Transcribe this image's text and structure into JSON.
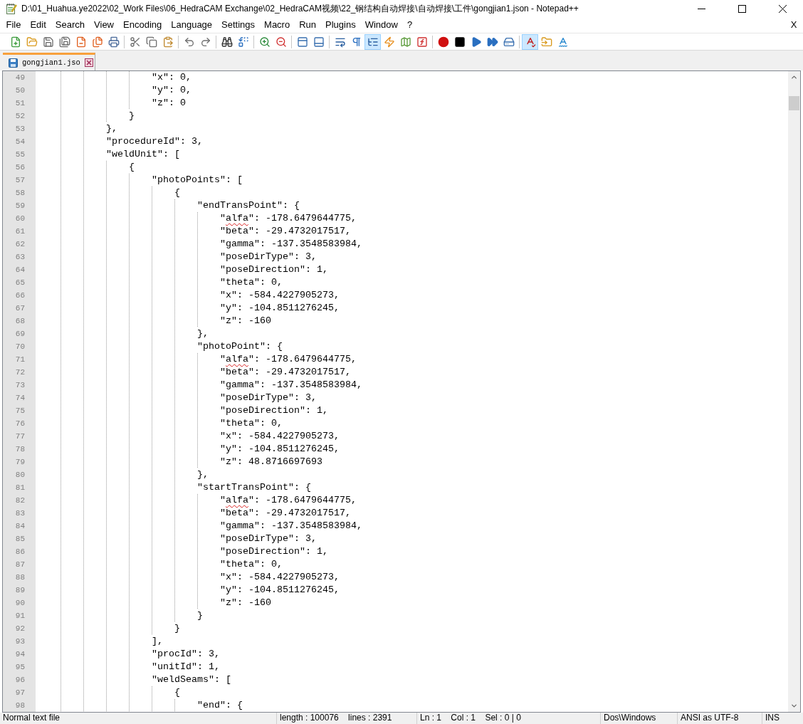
{
  "window": {
    "title": "D:\\01_Huahua.ye2022\\02_Work Files\\06_HedraCAM Exchange\\02_HedraCAM视频\\22_钢结构自动焊接\\自动焊接\\工件\\gongjian1.json - Notepad++"
  },
  "menu": {
    "items": [
      "File",
      "Edit",
      "Search",
      "View",
      "Encoding",
      "Language",
      "Settings",
      "Macro",
      "Run",
      "Plugins",
      "Window",
      "?"
    ],
    "close": "X"
  },
  "toolbar": {
    "groups": [
      {
        "buttons": [
          {
            "pressed": false
          },
          {
            "pressed": false
          },
          {
            "pressed": false
          },
          {
            "pressed": false
          },
          {
            "pressed": false
          },
          {
            "pressed": false
          },
          {
            "pressed": false
          }
        ]
      },
      {
        "buttons": [
          {
            "pressed": false
          },
          {
            "pressed": false
          },
          {
            "pressed": false
          }
        ]
      },
      {
        "buttons": [
          {
            "pressed": false
          },
          {
            "pressed": false
          }
        ]
      },
      {
        "buttons": [
          {
            "pressed": false
          },
          {
            "pressed": false
          }
        ]
      },
      {
        "buttons": [
          {
            "pressed": false
          },
          {
            "pressed": false
          }
        ]
      },
      {
        "buttons": [
          {
            "pressed": false
          },
          {
            "pressed": false
          }
        ]
      },
      {
        "buttons": [
          {
            "pressed": false
          },
          {
            "pressed": false
          },
          {
            "pressed": true
          },
          {
            "pressed": false
          },
          {
            "pressed": false
          },
          {
            "pressed": false
          }
        ]
      },
      {
        "buttons": [
          {
            "pressed": false
          },
          {
            "pressed": false
          },
          {
            "pressed": false
          },
          {
            "pressed": false
          },
          {
            "pressed": false
          }
        ]
      },
      {
        "buttons": [
          {
            "pressed": true
          },
          {
            "pressed": false
          },
          {
            "pressed": false
          }
        ]
      }
    ]
  },
  "tabs": [
    {
      "label": "gongjian1.jso",
      "selected": true
    }
  ],
  "editor": {
    "lines": [
      {
        "number": "49",
        "text": "                    \"x\": 0,"
      },
      {
        "number": "50",
        "text": "                    \"y\": 0,"
      },
      {
        "number": "51",
        "text": "                    \"z\": 0"
      },
      {
        "number": "52",
        "text": "                }"
      },
      {
        "number": "53",
        "text": "            },"
      },
      {
        "number": "54",
        "text": "            \"procedureId\": 3,"
      },
      {
        "number": "55",
        "text": "            \"weldUnit\": ["
      },
      {
        "number": "56",
        "text": "                {"
      },
      {
        "number": "57",
        "text": "                    \"photoPoints\": ["
      },
      {
        "number": "58",
        "text": "                        {"
      },
      {
        "number": "59",
        "text": "                            \"endTransPoint\": {"
      },
      {
        "number": "60",
        "parts": [
          {
            "text": "                                \"",
            "misspelled": false
          },
          {
            "text": "alfa",
            "misspelled": true
          },
          {
            "text": "\": -178.6479644775,",
            "misspelled": false
          }
        ]
      },
      {
        "number": "61",
        "text": "                                \"beta\": -29.4732017517,"
      },
      {
        "number": "62",
        "text": "                                \"gamma\": -137.3548583984,"
      },
      {
        "number": "63",
        "text": "                                \"poseDirType\": 3,"
      },
      {
        "number": "64",
        "text": "                                \"poseDirection\": 1,"
      },
      {
        "number": "65",
        "text": "                                \"theta\": 0,"
      },
      {
        "number": "66",
        "text": "                                \"x\": -584.4227905273,"
      },
      {
        "number": "67",
        "text": "                                \"y\": -104.8511276245,"
      },
      {
        "number": "68",
        "text": "                                \"z\": -160"
      },
      {
        "number": "69",
        "text": "                            },"
      },
      {
        "number": "70",
        "text": "                            \"photoPoint\": {"
      },
      {
        "number": "71",
        "parts": [
          {
            "text": "                                \"",
            "misspelled": false
          },
          {
            "text": "alfa",
            "misspelled": true
          },
          {
            "text": "\": -178.6479644775,",
            "misspelled": false
          }
        ]
      },
      {
        "number": "72",
        "text": "                                \"beta\": -29.4732017517,"
      },
      {
        "number": "73",
        "text": "                                \"gamma\": -137.3548583984,"
      },
      {
        "number": "74",
        "text": "                                \"poseDirType\": 3,"
      },
      {
        "number": "75",
        "text": "                                \"poseDirection\": 1,"
      },
      {
        "number": "76",
        "text": "                                \"theta\": 0,"
      },
      {
        "number": "77",
        "text": "                                \"x\": -584.4227905273,"
      },
      {
        "number": "78",
        "text": "                                \"y\": -104.8511276245,"
      },
      {
        "number": "79",
        "text": "                                \"z\": 48.8716697693"
      },
      {
        "number": "80",
        "text": "                            },"
      },
      {
        "number": "81",
        "text": "                            \"startTransPoint\": {"
      },
      {
        "number": "82",
        "parts": [
          {
            "text": "                                \"",
            "misspelled": false
          },
          {
            "text": "alfa",
            "misspelled": true
          },
          {
            "text": "\": -178.6479644775,",
            "misspelled": false
          }
        ]
      },
      {
        "number": "83",
        "text": "                                \"beta\": -29.4732017517,"
      },
      {
        "number": "84",
        "text": "                                \"gamma\": -137.3548583984,"
      },
      {
        "number": "85",
        "text": "                                \"poseDirType\": 3,"
      },
      {
        "number": "86",
        "text": "                                \"poseDirection\": 1,"
      },
      {
        "number": "87",
        "text": "                                \"theta\": 0,"
      },
      {
        "number": "88",
        "text": "                                \"x\": -584.4227905273,"
      },
      {
        "number": "89",
        "text": "                                \"y\": -104.8511276245,"
      },
      {
        "number": "90",
        "text": "                                \"z\": -160"
      },
      {
        "number": "91",
        "text": "                            }"
      },
      {
        "number": "92",
        "text": "                        }"
      },
      {
        "number": "93",
        "text": "                    ],"
      },
      {
        "number": "94",
        "text": "                    \"procId\": 3,"
      },
      {
        "number": "95",
        "text": "                    \"unitId\": 1,"
      },
      {
        "number": "96",
        "text": "                    \"weldSeams\": ["
      },
      {
        "number": "97",
        "text": "                        {"
      },
      {
        "number": "98",
        "text": "                            \"end\": {"
      }
    ]
  },
  "status_bar": [
    "Normal text file",
    "length : 100076    lines : 2391",
    "Ln : 1    Col : 1    Sel : 0 | 0",
    "Dos\\Windows",
    "ANSI as UTF-8",
    "INS"
  ]
}
